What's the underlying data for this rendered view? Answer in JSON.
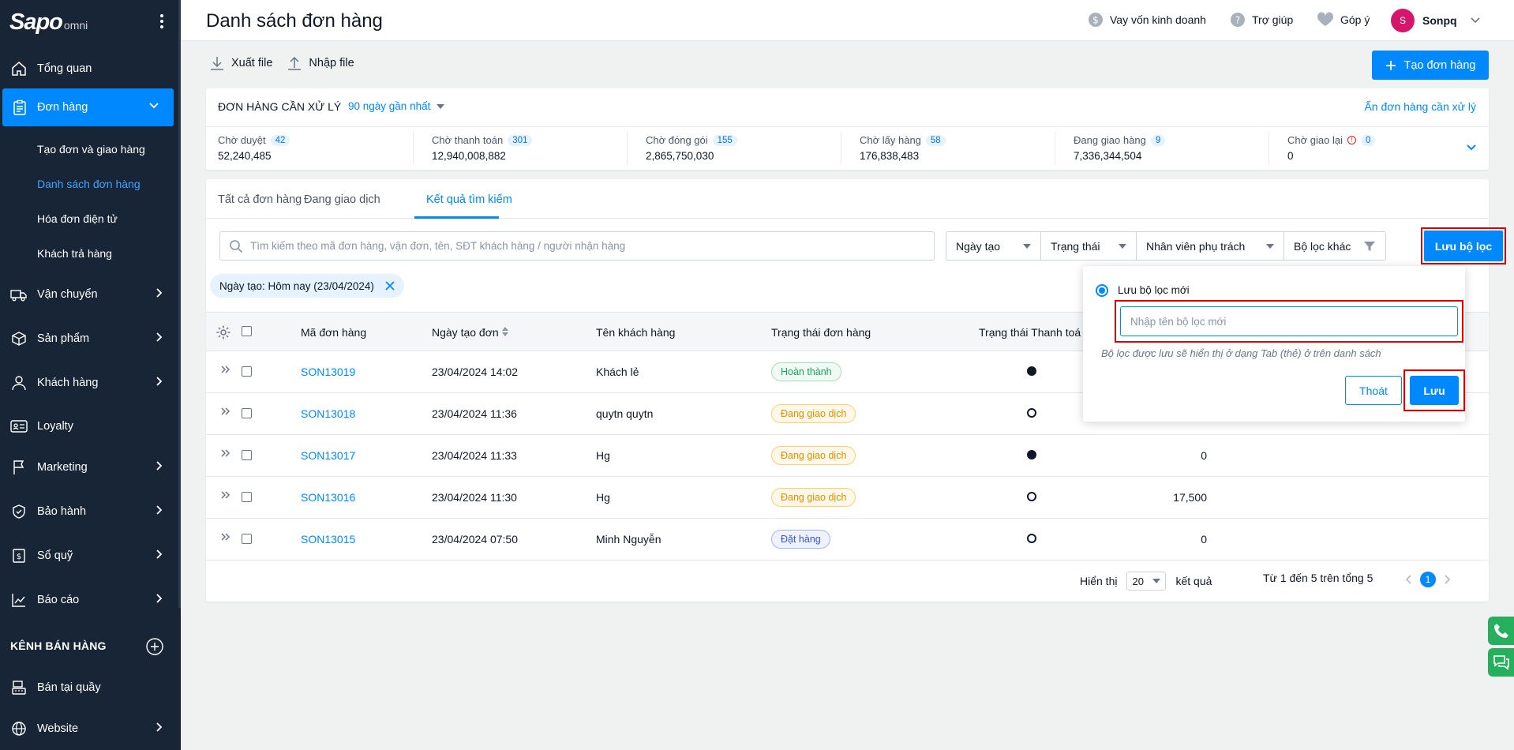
{
  "app": {
    "logo": "Sapo",
    "logo_sub": "omni"
  },
  "sidebar": {
    "items": [
      {
        "label": "Tổng quan",
        "icon": "home-icon"
      },
      {
        "label": "Đơn hàng",
        "icon": "clipboard-icon"
      },
      {
        "label": "Vận chuyển",
        "icon": "truck-icon"
      },
      {
        "label": "Sản phẩm",
        "icon": "box-icon"
      },
      {
        "label": "Khách hàng",
        "icon": "user-icon"
      },
      {
        "label": "Loyalty",
        "icon": "id-card-icon"
      },
      {
        "label": "Marketing",
        "icon": "flag-icon"
      },
      {
        "label": "Bảo hành",
        "icon": "shield-icon"
      },
      {
        "label": "Sổ quỹ",
        "icon": "cashbook-icon"
      },
      {
        "label": "Báo cáo",
        "icon": "chart-line-icon"
      }
    ],
    "sub_items": [
      {
        "label": "Tạo đơn và giao hàng"
      },
      {
        "label": "Danh sách đơn hàng"
      },
      {
        "label": "Hóa đơn điện tử"
      },
      {
        "label": "Khách trả hàng"
      }
    ],
    "channels_title": "KÊNH BÁN HÀNG",
    "channels": [
      {
        "label": "Bán tại quầy",
        "icon": "pos-icon"
      },
      {
        "label": "Website",
        "icon": "globe-icon"
      }
    ]
  },
  "header": {
    "title": "Danh sách đơn hàng",
    "loan": "Vay vốn kinh doanh",
    "help": "Trợ giúp",
    "feedback": "Góp ý",
    "user_initial": "S",
    "user_name": "Sonpq"
  },
  "actions": {
    "export": "Xuất file",
    "import": "Nhập file",
    "create": "Tạo đơn hàng"
  },
  "pending": {
    "title": "ĐƠN HÀNG CẦN XỬ LÝ",
    "period": "90 ngày gần nhất",
    "hide": "Ẩn đơn hàng cần xử lý",
    "stats": [
      {
        "label": "Chờ duyệt",
        "count": "42",
        "value": "52,240,485"
      },
      {
        "label": "Chờ thanh toán",
        "count": "301",
        "value": "12,940,008,882"
      },
      {
        "label": "Chờ đóng gói",
        "count": "155",
        "value": "2,865,750,030"
      },
      {
        "label": "Chờ lấy hàng",
        "count": "58",
        "value": "176,838,483"
      },
      {
        "label": "Đang giao hàng",
        "count": "9",
        "value": "7,336,344,504"
      },
      {
        "label": "Chờ giao lại",
        "count": "0",
        "value": "0"
      }
    ]
  },
  "tabs": [
    {
      "label": "Tất cả đơn hàng"
    },
    {
      "label": "Đang giao dịch"
    },
    {
      "label": "Kết quả tìm kiếm"
    }
  ],
  "search": {
    "placeholder": "Tìm kiếm theo mã đơn hàng, vận đơn, tên, SĐT khách hàng / người nhận hàng"
  },
  "filters": {
    "created": "Ngày tạo",
    "status": "Trạng thái",
    "staff": "Nhân viên phụ trách",
    "other": "Bộ lọc khác",
    "save_filter": "Lưu bộ lọc"
  },
  "active_filter": "Ngày tạo: Hôm nay (23/04/2024)",
  "table": {
    "columns": {
      "code": "Mã đơn hàng",
      "date": "Ngày tạo đơn",
      "customer": "Tên khách hàng",
      "status": "Trạng thái đơn hàng",
      "payment": "Trạng thái Thanh toá"
    },
    "rows": [
      {
        "code": "SON13019",
        "date": "23/04/2024 14:02",
        "customer": "Khách lẻ",
        "status": "Hoàn thành",
        "status_type": "done",
        "paid": true,
        "amount": ""
      },
      {
        "code": "SON13018",
        "date": "23/04/2024 11:36",
        "customer": "quytn quytn",
        "status": "Đang giao dịch",
        "status_type": "ship",
        "paid": false,
        "amount": ""
      },
      {
        "code": "SON13017",
        "date": "23/04/2024 11:33",
        "customer": "Hg",
        "status": "Đang giao dịch",
        "status_type": "ship",
        "paid": true,
        "amount": "0"
      },
      {
        "code": "SON13016",
        "date": "23/04/2024 11:30",
        "customer": "Hg",
        "status": "Đang giao dịch",
        "status_type": "ship",
        "paid": false,
        "amount": "17,500"
      },
      {
        "code": "SON13015",
        "date": "23/04/2024 07:50",
        "customer": "Minh Nguyễn",
        "status": "Đặt hàng",
        "status_type": "order",
        "paid": false,
        "amount": "0"
      }
    ]
  },
  "pager": {
    "show": "Hiển thị",
    "per_page": "20",
    "results": "kết quả",
    "summary": "Từ 1 đến 5 trên tổng 5",
    "current": "1"
  },
  "popover": {
    "option": "Lưu bộ lọc mới",
    "placeholder": "Nhập tên bộ lọc mới",
    "note": "Bộ lọc được lưu sẽ hiển thị ở dạng Tab (thẻ) ở trên danh sách",
    "cancel": "Thoát",
    "save": "Lưu"
  },
  "colors": {
    "primary": "#0088ff",
    "sidebar": "#182537",
    "highlight": "#e00000"
  }
}
